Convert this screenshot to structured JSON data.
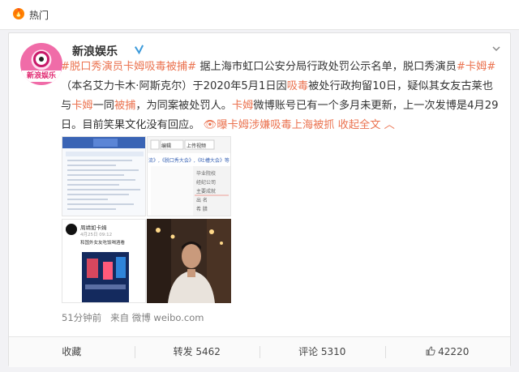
{
  "hot_bar": {
    "icon": "flame-icon",
    "label": "热门"
  },
  "post": {
    "author": "新浪娱乐",
    "avatar_tag": "新浪娱乐",
    "topic": "#脱口秀演员卡姆吸毒被捕#",
    "text_1": " 据上海市虹口公安分局行政处罚公示名单，脱口秀演员",
    "hashtag_open": "#卡姆#",
    "text_2": "（本名艾力卡木·阿斯克尔）于2020年5月1日因",
    "drug": "吸毒",
    "text_3": "被处行政拘留10日，疑似其女友古莱也与",
    "name_kamu": "卡姆",
    "text_4": "一同",
    "arrested": "被捕",
    "text_5": "，为同案被处罚人。",
    "name_kamu2": "卡姆",
    "text_6": "微博账号已有一个多月未更新，上一次发博是4月29日。目前笑果文化没有回应。",
    "link_icon": "eye-icon",
    "link_text": "曝卡姆涉嫌吸毒上海被抓",
    "expand": "收起全文",
    "time": "51分钟前",
    "source": "来自 微博 weibo.com",
    "brand_color": "#eb7350"
  },
  "images": {
    "img2_crumbs": "流》,《脱口秀大会》,《吐槽大会》等",
    "img2_button1": "编辑",
    "img2_button2": "上传视频",
    "img2_menu": [
      "毕业院校",
      "经纪公司",
      "主要成就",
      "出 名",
      "希 腊"
    ],
    "img3_name": "周靖如卡姆",
    "img3_date": "4月25日 09:12",
    "img3_text": "和国外女友吃饭喝酒看"
  },
  "actions": {
    "favorite": "收藏",
    "repost": "转发 5462",
    "comment": "评论 5310",
    "like": "42220",
    "like_icon": "thumbs-up-icon"
  }
}
